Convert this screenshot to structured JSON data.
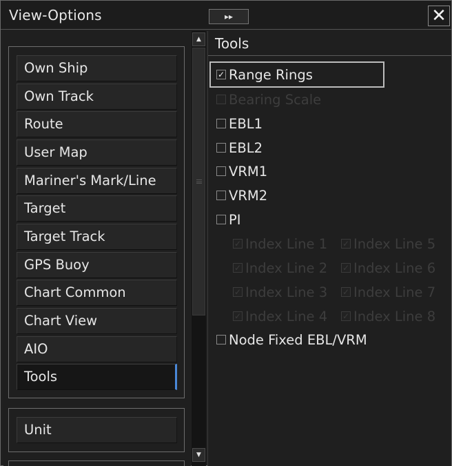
{
  "window": {
    "title": "View-Options",
    "collapse_glyph": "▸▸",
    "close_glyph": "✕"
  },
  "sidebar": {
    "items": [
      {
        "label": "Own Ship"
      },
      {
        "label": "Own Track"
      },
      {
        "label": "Route"
      },
      {
        "label": "User Map"
      },
      {
        "label": "Mariner's Mark/Line"
      },
      {
        "label": "Target"
      },
      {
        "label": "Target Track"
      },
      {
        "label": "GPS Buoy"
      },
      {
        "label": "Chart Common"
      },
      {
        "label": "Chart View"
      },
      {
        "label": "AIO"
      },
      {
        "label": "Tools",
        "selected": true
      }
    ],
    "unit_label": "Unit"
  },
  "scrollbar": {
    "up_glyph": "▲",
    "down_glyph": "▼"
  },
  "tools": {
    "header": "Tools",
    "range_rings": {
      "label": "Range Rings",
      "checked": true,
      "enabled": true
    },
    "bearing_scale": {
      "label": "Bearing Scale",
      "checked": false,
      "enabled": false
    },
    "ebl1": {
      "label": "EBL1",
      "checked": false,
      "enabled": true
    },
    "ebl2": {
      "label": "EBL2",
      "checked": false,
      "enabled": true
    },
    "vrm1": {
      "label": "VRM1",
      "checked": false,
      "enabled": true
    },
    "vrm2": {
      "label": "VRM2",
      "checked": false,
      "enabled": true
    },
    "pi": {
      "label": "PI",
      "checked": false,
      "enabled": true
    },
    "index_lines": [
      {
        "label": "Index Line 1",
        "checked": true,
        "enabled": false
      },
      {
        "label": "Index Line 2",
        "checked": true,
        "enabled": false
      },
      {
        "label": "Index Line 3",
        "checked": true,
        "enabled": false
      },
      {
        "label": "Index Line 4",
        "checked": true,
        "enabled": false
      },
      {
        "label": "Index Line 5",
        "checked": true,
        "enabled": false
      },
      {
        "label": "Index Line 6",
        "checked": true,
        "enabled": false
      },
      {
        "label": "Index Line 7",
        "checked": true,
        "enabled": false
      },
      {
        "label": "Index Line 8",
        "checked": true,
        "enabled": false
      }
    ],
    "node_fixed": {
      "label": "Node Fixed EBL/VRM",
      "checked": false,
      "enabled": true
    }
  },
  "colors": {
    "background": "#202020",
    "accent_selected": "#4a88d8",
    "disabled_text": "#3d3d3d"
  }
}
